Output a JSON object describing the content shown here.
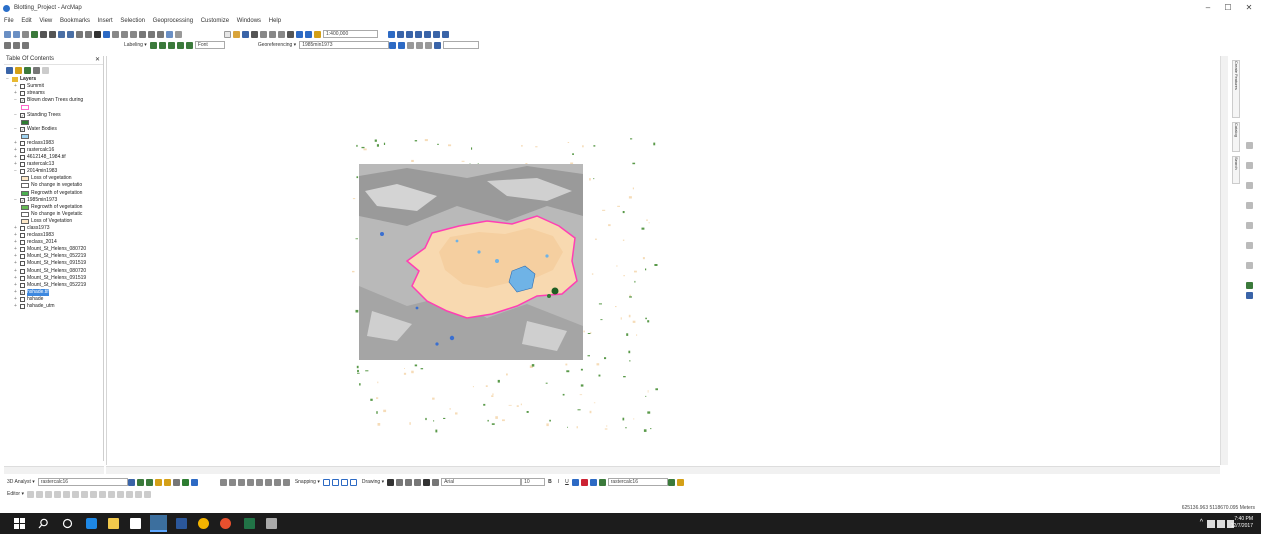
{
  "window": {
    "title": "Blotting_Project - ArcMap",
    "minimize": "–",
    "maximize": "☐",
    "close": "✕"
  },
  "menu": [
    "File",
    "Edit",
    "View",
    "Bookmarks",
    "Insert",
    "Selection",
    "Geoprocessing",
    "Customize",
    "Windows",
    "Help"
  ],
  "toolbar": {
    "scale": "1:400,000",
    "labeling": "Labeling ▾",
    "font_box": "Font",
    "georeferencing": "Georeferencing ▾",
    "georef_layer": "1985min1973"
  },
  "toc": {
    "title": "Table Of Contents",
    "layers": [
      {
        "label": "Layers",
        "kind": "group",
        "level": 0,
        "exp": "−"
      },
      {
        "label": "Summit",
        "kind": "layer",
        "level": 1,
        "checked": false,
        "exp": "+"
      },
      {
        "label": "streams",
        "kind": "layer",
        "level": 1,
        "checked": false,
        "exp": "+"
      },
      {
        "label": "Blown down Trees during",
        "kind": "layer",
        "level": 1,
        "checked": true,
        "exp": "−"
      },
      {
        "label": "",
        "kind": "swatch",
        "level": 2,
        "color": "#ff66cc",
        "outline": true
      },
      {
        "label": "Standing Trees",
        "kind": "layer",
        "level": 1,
        "checked": true,
        "exp": "−"
      },
      {
        "label": "",
        "kind": "swatch",
        "level": 2,
        "color": "#2e7d32"
      },
      {
        "label": "Water Bodies",
        "kind": "layer",
        "level": 1,
        "checked": true,
        "exp": "−"
      },
      {
        "label": "",
        "kind": "swatch",
        "level": 2,
        "color": "#9fd3f0"
      },
      {
        "label": "reclass1983",
        "kind": "layer",
        "level": 1,
        "checked": false,
        "exp": "+"
      },
      {
        "label": "rastercalc16",
        "kind": "layer",
        "level": 1,
        "checked": false,
        "exp": "+"
      },
      {
        "label": "4612148_1984.tif",
        "kind": "layer",
        "level": 1,
        "checked": false,
        "exp": "+"
      },
      {
        "label": "rastercalc13",
        "kind": "layer",
        "level": 1,
        "checked": false,
        "exp": "+"
      },
      {
        "label": "2014min1983",
        "kind": "layer",
        "level": 1,
        "checked": false,
        "exp": "−"
      },
      {
        "label": "Loss of vegetation",
        "kind": "legend",
        "level": 2,
        "color": "#fde8c8"
      },
      {
        "label": "No change in vegetatio",
        "kind": "legend",
        "level": 2,
        "color": "#ffffff"
      },
      {
        "label": "Regrowth of vegetation",
        "kind": "legend",
        "level": 2,
        "color": "#4caf50"
      },
      {
        "label": "1985min1973",
        "kind": "layer",
        "level": 1,
        "checked": true,
        "exp": "−"
      },
      {
        "label": "Regrowth of vegetation",
        "kind": "legend",
        "level": 2,
        "color": "#66bb55"
      },
      {
        "label": "No change in Vegetatic",
        "kind": "legend",
        "level": 2,
        "color": "#ffffff"
      },
      {
        "label": "Loss of Vegetation",
        "kind": "legend",
        "level": 2,
        "color": "#fde8c8"
      },
      {
        "label": "class1973",
        "kind": "layer",
        "level": 1,
        "checked": false,
        "exp": "+"
      },
      {
        "label": "reclass1983",
        "kind": "layer",
        "level": 1,
        "checked": false,
        "exp": "+"
      },
      {
        "label": "reclass_2014",
        "kind": "layer",
        "level": 1,
        "checked": false,
        "exp": "+"
      },
      {
        "label": "Mount_St_Helens_080720",
        "kind": "layer",
        "level": 1,
        "checked": false,
        "exp": "+"
      },
      {
        "label": "Mount_St_Helens_052219",
        "kind": "layer",
        "level": 1,
        "checked": false,
        "exp": "+"
      },
      {
        "label": "Mount_St_Helens_091519",
        "kind": "layer",
        "level": 1,
        "checked": false,
        "exp": "+"
      },
      {
        "label": "Mount_St_Helens_080720",
        "kind": "layer",
        "level": 1,
        "checked": false,
        "exp": "+"
      },
      {
        "label": "Mount_St_Helens_091519",
        "kind": "layer",
        "level": 1,
        "checked": false,
        "exp": "+"
      },
      {
        "label": "Mount_St_Helens_052219",
        "kind": "layer",
        "level": 1,
        "checked": false,
        "exp": "+"
      },
      {
        "label": "hshade.tif",
        "kind": "layer",
        "level": 1,
        "checked": true,
        "exp": "+",
        "selected": true
      },
      {
        "label": "hshade",
        "kind": "layer",
        "level": 1,
        "checked": false,
        "exp": "+"
      },
      {
        "label": "hshade_utm",
        "kind": "layer",
        "level": 1,
        "checked": false,
        "exp": "+"
      }
    ]
  },
  "right_dock": {
    "tabs": [
      "Create Features",
      "Catalog",
      "Search"
    ]
  },
  "bottom_toolbars": {
    "analyst_label": "3D Analyst ▾",
    "analyst_layer": "rastercalc16",
    "snapping": "Snapping ▾",
    "drawing": "Drawing ▾",
    "font": "Arial",
    "font_size": "10",
    "bold": "B",
    "italic": "I",
    "underline": "U",
    "layer2": "rastercalc16",
    "editor": "Editor ▾"
  },
  "status": {
    "coordinates": "625136.963  5118670.095 Meters"
  },
  "taskbar": {
    "time": "7:40 PM",
    "date": "12/7/2017"
  }
}
